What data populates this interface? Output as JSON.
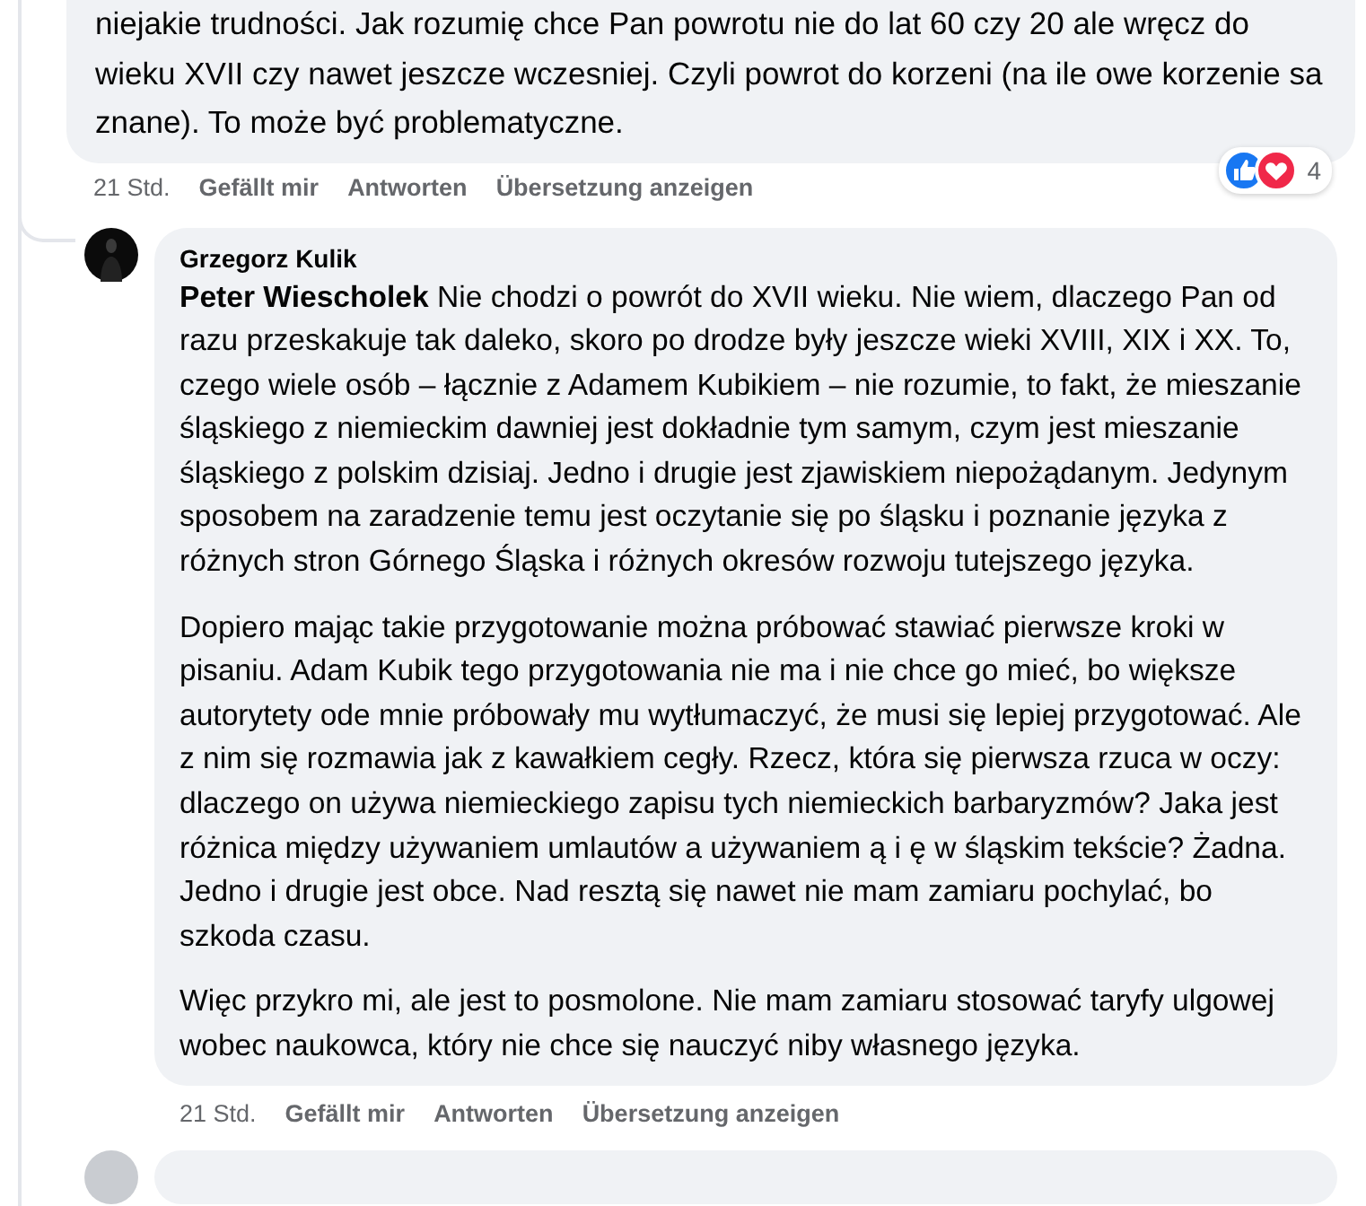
{
  "top_comment": {
    "text": "niejakie trudności. Jak rozumię chce Pan powrotu nie do lat 60 czy 20 ale wręcz do wieku XVII czy nawet jeszcze wczesniej. Czyli powrot do korzeni (na ile owe korzenie sa znane). To może być problematyczne.",
    "time": "21 Std.",
    "actions": [
      "Gefällt mir",
      "Antworten",
      "Übersetzung anzeigen"
    ],
    "reaction_count": "4"
  },
  "reply": {
    "author": "Grzegorz Kulik",
    "paragraphs": [
      "**Peter Wiescholek** Nie chodzi o powrót do XVII wieku. Nie wiem, dlaczego Pan od razu przeskakuje tak daleko, skoro po drodze były jeszcze wieki XVIII, XIX i XX. To, czego wiele osób – łącznie z Adamem Kubikiem – nie rozumie, to fakt, że mieszanie śląskiego z niemieckim dawniej jest dokładnie tym samym, czym jest mieszanie śląskiego z polskim dzisiaj. Jedno i drugie jest zjawiskiem niepożądanym. Jedynym sposobem na zaradzenie temu jest oczytanie się po śląsku i poznanie języka z różnych stron Górnego Śląska i różnych okresów rozwoju tutejszego języka.",
      "Dopiero mając takie przygotowanie można próbować stawiać pierwsze kroki w pisaniu. Adam Kubik tego przygotowania nie ma i nie chce go mieć, bo większe autorytety ode mnie próbowały mu wytłumaczyć, że musi się lepiej przygotować. Ale z nim się rozmawia jak z kawałkiem cegły. Rzecz, która się pierwsza rzuca w oczy: dlaczego on używa niemieckiego zapisu tych niemieckich barbaryzmów? Jaka jest różnica między używaniem umlautów a używaniem ą i ę w śląskim tekście? Żadna. Jedno i drugie jest obce. Nad resztą się nawet nie mam zamiaru pochylać, bo szkoda czasu.",
      "Więc przykro mi, ale jest to posmolone. Nie mam zamiaru stosować taryfy ulgowej wobec naukowca, który nie chce się nauczyć niby własnego języka."
    ],
    "time": "21 Std.",
    "actions": [
      "Gefällt mir",
      "Antworten",
      "Übersetzung anzeigen"
    ]
  }
}
